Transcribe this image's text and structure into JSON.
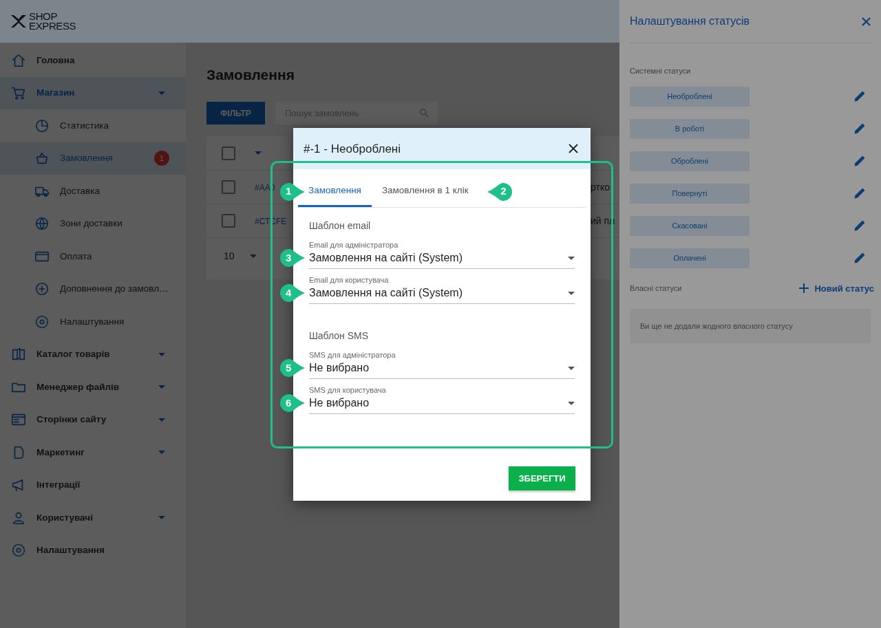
{
  "topbar": {
    "logo_line1": "SHOP",
    "logo_line2": "EXPRESS"
  },
  "sidebar": {
    "items": [
      {
        "label": "Головна",
        "kind": "link",
        "selected": false
      },
      {
        "label": "Магазин",
        "kind": "group",
        "selected": true,
        "children": [
          {
            "label": "Статистика",
            "selected": false
          },
          {
            "label": "Замовлення",
            "selected": true,
            "badge": "1"
          },
          {
            "label": "Доставка",
            "selected": false
          },
          {
            "label": "Зони доставки",
            "selected": false
          },
          {
            "label": "Оплата",
            "selected": false
          },
          {
            "label": "Доповнення до замовл…",
            "selected": false
          },
          {
            "label": "Налаштування",
            "selected": false
          }
        ]
      },
      {
        "label": "Каталог товарів",
        "kind": "group",
        "selected": false
      },
      {
        "label": "Менеджер файлів",
        "kind": "group",
        "selected": false
      },
      {
        "label": "Сторінки сайту",
        "kind": "group",
        "selected": false
      },
      {
        "label": "Маркетинг",
        "kind": "group",
        "selected": false
      },
      {
        "label": "Інтеграції",
        "kind": "link",
        "selected": false
      },
      {
        "label": "Користувачі",
        "kind": "group",
        "selected": false
      },
      {
        "label": "Налаштування",
        "kind": "link",
        "selected": false
      }
    ]
  },
  "main": {
    "title": "Замовлення",
    "filter_button": "ФІЛЬТР",
    "search": {
      "placeholder": "Пошук замовлень"
    },
    "table": {
      "header_checked": false,
      "rows": [
        {
          "checked": false,
          "order": "#АА0",
          "column_3": "ртко"
        },
        {
          "checked": false,
          "order": "#СТCFE",
          "column_3": "ий пл"
        }
      ]
    },
    "pagination": {
      "per_page": "10"
    }
  },
  "drawer": {
    "title": "Налаштування статусів",
    "system_label": "Системні статуси",
    "statuses": [
      "Необроблені",
      "В роботі",
      "Оброблені",
      "Повернуті",
      "Скасовані",
      "Оплачені"
    ],
    "custom_label": "Власні статуси",
    "new_status_button": "Новий статус",
    "empty_message": "Ви ще не додали жодного власного статусу"
  },
  "modal": {
    "title": "#-1 - Необроблені",
    "tabs": [
      {
        "label": "Замовлення",
        "selected": true,
        "marker": "1"
      },
      {
        "label": "Замовлення в 1 клік",
        "selected": false,
        "marker": "2"
      }
    ],
    "sections": [
      {
        "heading": "Шаблон email",
        "fields": [
          {
            "label": "Email для адміністратора",
            "value": "Замовлення на сайті (System)",
            "marker": "3"
          },
          {
            "label": "Email для користувача",
            "value": "Замовлення на сайті (System)",
            "marker": "4"
          }
        ]
      },
      {
        "heading": "Шаблон SMS",
        "fields": [
          {
            "label": "SMS для адміністратора",
            "value": "Не вибрано",
            "marker": "5"
          },
          {
            "label": "SMS для користувача",
            "value": "Не вибрано",
            "marker": "6"
          }
        ]
      }
    ],
    "save_button": "ЗБЕРЕГТИ"
  }
}
